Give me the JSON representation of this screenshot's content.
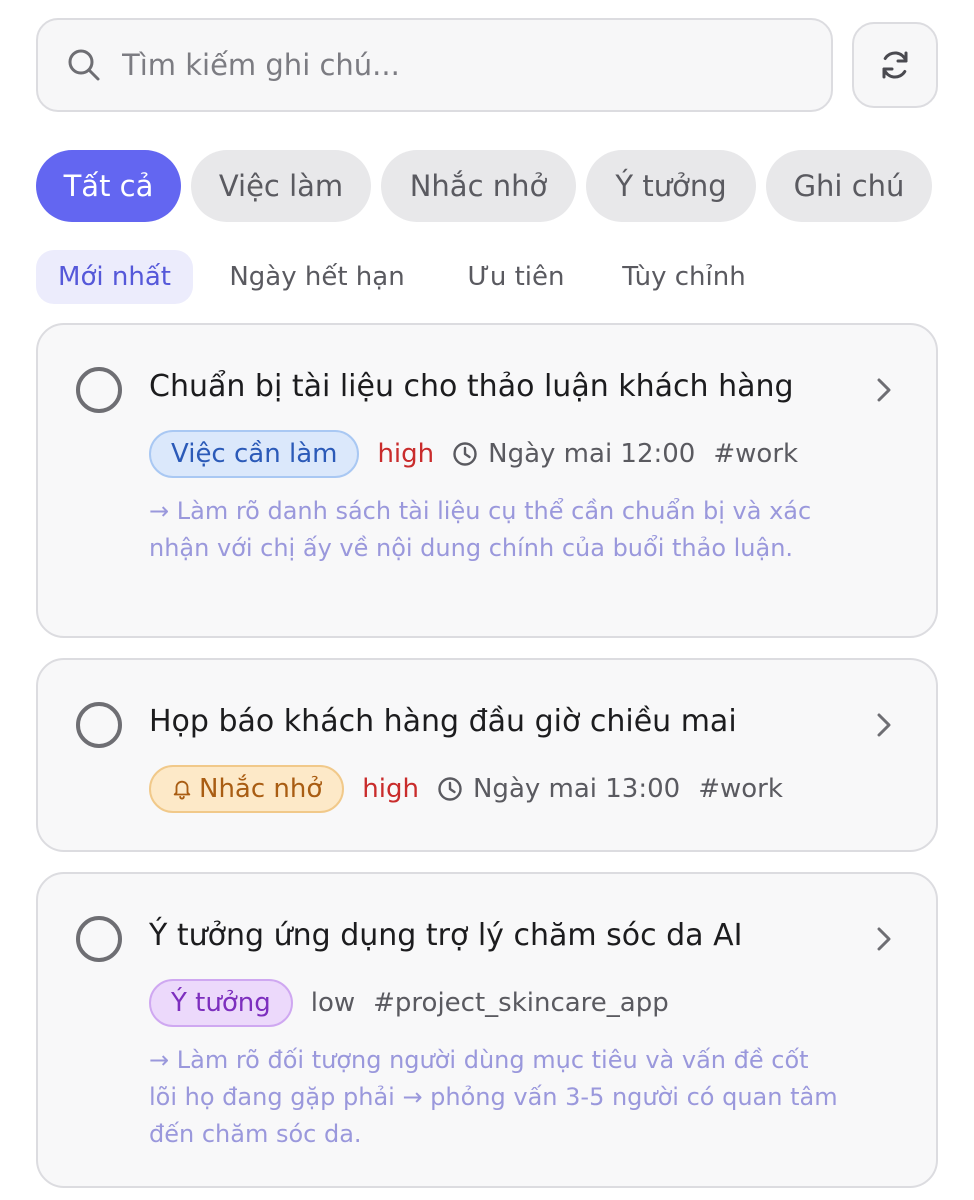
{
  "search": {
    "placeholder": "Tìm kiếm ghi chú..."
  },
  "filters": [
    {
      "label": "Tất cả",
      "active": true
    },
    {
      "label": "Việc làm",
      "active": false
    },
    {
      "label": "Nhắc nhở",
      "active": false
    },
    {
      "label": "Ý tưởng",
      "active": false
    },
    {
      "label": "Ghi chú",
      "active": false
    }
  ],
  "sort_tabs": [
    {
      "label": "Mới nhất",
      "active": true
    },
    {
      "label": "Ngày hết hạn",
      "active": false
    },
    {
      "label": "Ưu tiên",
      "active": false
    },
    {
      "label": "Tùy chỉnh",
      "active": false
    }
  ],
  "notes": [
    {
      "title": "Chuẩn bị tài liệu cho thảo luận khách hàng",
      "badge": "Việc cần làm",
      "priority": "high",
      "due": "Ngày mai 12:00",
      "tag": "#work",
      "note": "→ Làm rõ danh sách tài liệu cụ thể cần chuẩn bị và xác nhận với chị ấy về nội dung chính của buổi thảo luận."
    },
    {
      "title": "Họp báo khách hàng đầu giờ chiều mai",
      "badge": "Nhắc nhở",
      "priority": "high",
      "due": "Ngày mai 13:00",
      "tag": "#work"
    },
    {
      "title": "Ý tưởng ứng dụng trợ lý chăm sóc da AI",
      "badge": "Ý tưởng",
      "priority": "low",
      "tag": "#project_skincare_app",
      "note": "→ Làm rõ đối tượng người dùng mục tiêu và vấn đề cốt lõi họ đang gặp phải → phỏng vấn 3-5 người có quan tâm đến chăm sóc da."
    }
  ],
  "colors": {
    "accent": "#6366f1",
    "priority_high": "#c92c2c",
    "note_text": "#9a98dc"
  }
}
